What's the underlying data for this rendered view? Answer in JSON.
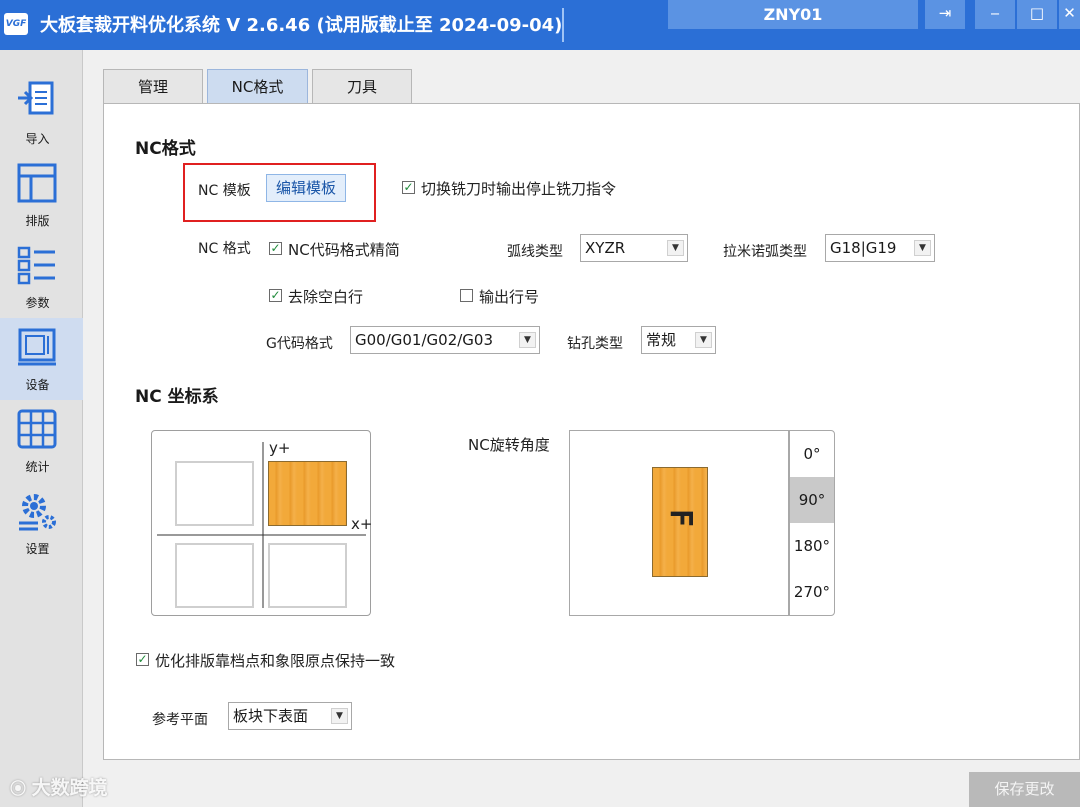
{
  "titlebar": {
    "logo_text": "VGF",
    "title": "大板套裁开料优化系统  V 2.6.46  (试用版截止至 2024-09-04)",
    "user": "ZNY01",
    "logout_icon": "⇥",
    "min_icon": "‒",
    "max_icon": "□",
    "close_icon": "✕"
  },
  "sidebar": {
    "items": [
      {
        "label": "导入",
        "icon": "import-icon"
      },
      {
        "label": "排版",
        "icon": "layout-icon"
      },
      {
        "label": "参数",
        "icon": "params-icon"
      },
      {
        "label": "设备",
        "icon": "device-icon",
        "active": true
      },
      {
        "label": "统计",
        "icon": "stats-icon"
      },
      {
        "label": "设置",
        "icon": "settings-icon"
      }
    ]
  },
  "tabs": [
    {
      "label": "管理"
    },
    {
      "label": "NC格式",
      "active": true
    },
    {
      "label": "刀具"
    }
  ],
  "nc_format": {
    "section_title": "NC格式",
    "template_label": "NC 模板",
    "edit_template_button": "编辑模板",
    "stop_mill_cmd": {
      "label": "切换铣刀时输出停止铣刀指令",
      "checked": true
    },
    "format_label": "NC 格式",
    "code_simplify": {
      "label": "NC代码格式精简",
      "checked": true
    },
    "arc_type_label": "弧线类型",
    "arc_type_value": "XYZR",
    "lamino_arc_label": "拉米诺弧类型",
    "lamino_arc_value": "G18|G19",
    "remove_blank_lines": {
      "label": "去除空白行",
      "checked": true
    },
    "output_line_numbers": {
      "label": "输出行号",
      "checked": false
    },
    "gcode_format_label": "G代码格式",
    "gcode_format_value": "G00/G01/G02/G03",
    "drill_type_label": "钻孔类型",
    "drill_type_value": "常规"
  },
  "coordinate": {
    "section_title": "NC 坐标系",
    "y_axis_label": "y+",
    "x_axis_label": "x+",
    "rotation_label": "NC旋转角度",
    "rotation_options": [
      "0°",
      "90°",
      "180°",
      "270°"
    ],
    "rotation_selected": "90°",
    "glyph_text": "F"
  },
  "options": {
    "keep_origin_consistent": {
      "label": "优化排版靠档点和象限原点保持一致",
      "checked": true
    },
    "ref_plane_label": "参考平面",
    "ref_plane_value": "板块下表面"
  },
  "footer": {
    "save_button": "保存更改",
    "watermark": "大数跨境"
  },
  "colors": {
    "titlebar": "#2b6fd6",
    "wood": "#f2a93a",
    "highlight_box": "#e02020"
  }
}
